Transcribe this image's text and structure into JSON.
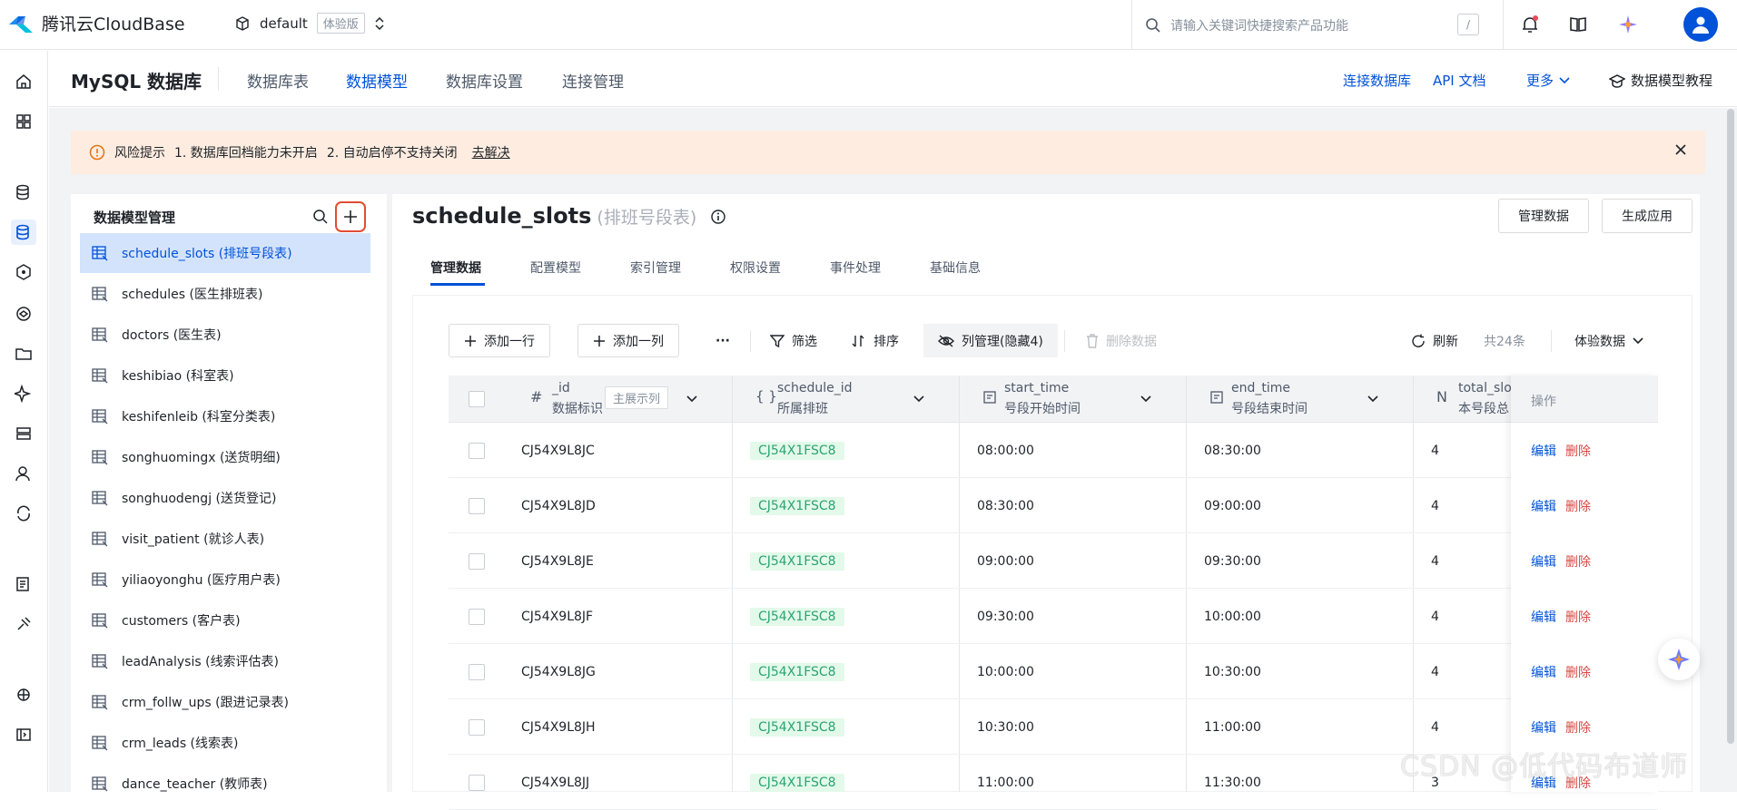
{
  "topbar": {
    "brand": "腾讯云CloudBase",
    "env_name": "default",
    "env_badge": "体验版",
    "search_placeholder": "请输入关键词快捷搜索产品功能",
    "search_shortcut": "/"
  },
  "subheader": {
    "title": "MySQL 数据库",
    "tabs": [
      "数据库表",
      "数据模型",
      "数据库设置",
      "连接管理"
    ],
    "active_tab": "数据模型",
    "links": {
      "connect": "连接数据库",
      "api": "API 文档",
      "more": "更多",
      "tutorial": "数据模型教程"
    }
  },
  "alert": {
    "label": "风险提示",
    "item1": "1. 数据库回档能力未开启",
    "item2": "2. 自动启停不支持关闭",
    "action": "去解决"
  },
  "model_panel": {
    "title": "数据模型管理",
    "items": [
      "schedule_slots (排班号段表)",
      "schedules (医生排班表)",
      "doctors (医生表)",
      "keshibiao (科室表)",
      "keshifenleib (科室分类表)",
      "songhuomingx (送货明细)",
      "songhuodengj (送货登记)",
      "visit_patient (就诊人表)",
      "yiliaoyonghu (医疗用户表)",
      "customers (客户表)",
      "leadAnalysis (线索评估表)",
      "crm_follw_ups (跟进记录表)",
      "crm_leads (线索表)",
      "dance_teacher (教师表)"
    ]
  },
  "main": {
    "title": "schedule_slots",
    "subtitle": "(排班号段表)",
    "btn_manage": "管理数据",
    "btn_generate": "生成应用",
    "tabs": [
      "管理数据",
      "配置模型",
      "索引管理",
      "权限设置",
      "事件处理",
      "基础信息"
    ],
    "toolbar": {
      "add_row": "添加一行",
      "add_col": "添加一列",
      "more": "···",
      "filter": "筛选",
      "sort": "排序",
      "columns": "列管理(隐藏4)",
      "delete": "删除数据",
      "refresh": "刷新",
      "count": "共24条",
      "data_env": "体验数据"
    }
  },
  "table": {
    "columns": [
      {
        "key": "_id",
        "label": "数据标识",
        "icon": "#"
      },
      {
        "key": "schedule_id",
        "label": "所属排班",
        "icon": "{ }"
      },
      {
        "key": "start_time",
        "label": "号段开始时间",
        "icon": "text-icon"
      },
      {
        "key": "end_time",
        "label": "号段结束时间",
        "icon": "text-icon"
      },
      {
        "key": "total_slo",
        "label": "本号段总",
        "icon": "N"
      }
    ],
    "main_col_hint": "主展示列",
    "op_header": "操作",
    "edit": "编辑",
    "delete": "删除",
    "rows": [
      {
        "id": "CJ54X9L8JC",
        "schedule": "CJ54X1FSC8",
        "start": "08:00:00",
        "end": "08:30:00",
        "total": "4"
      },
      {
        "id": "CJ54X9L8JD",
        "schedule": "CJ54X1FSC8",
        "start": "08:30:00",
        "end": "09:00:00",
        "total": "4"
      },
      {
        "id": "CJ54X9L8JE",
        "schedule": "CJ54X1FSC8",
        "start": "09:00:00",
        "end": "09:30:00",
        "total": "4"
      },
      {
        "id": "CJ54X9L8JF",
        "schedule": "CJ54X1FSC8",
        "start": "09:30:00",
        "end": "10:00:00",
        "total": "4"
      },
      {
        "id": "CJ54X9L8JG",
        "schedule": "CJ54X1FSC8",
        "start": "10:00:00",
        "end": "10:30:00",
        "total": "4"
      },
      {
        "id": "CJ54X9L8JH",
        "schedule": "CJ54X1FSC8",
        "start": "10:30:00",
        "end": "11:00:00",
        "total": "4"
      },
      {
        "id": "CJ54X9L8JJ",
        "schedule": "CJ54X1FSC8",
        "start": "11:00:00",
        "end": "11:30:00",
        "total": "3"
      }
    ]
  },
  "watermark": "CSDN @低代码布道师",
  "colors": {
    "accent": "#0052d9",
    "danger": "#d54941",
    "tag_green": "#2ba471",
    "alert_bg": "#fdecdf"
  }
}
